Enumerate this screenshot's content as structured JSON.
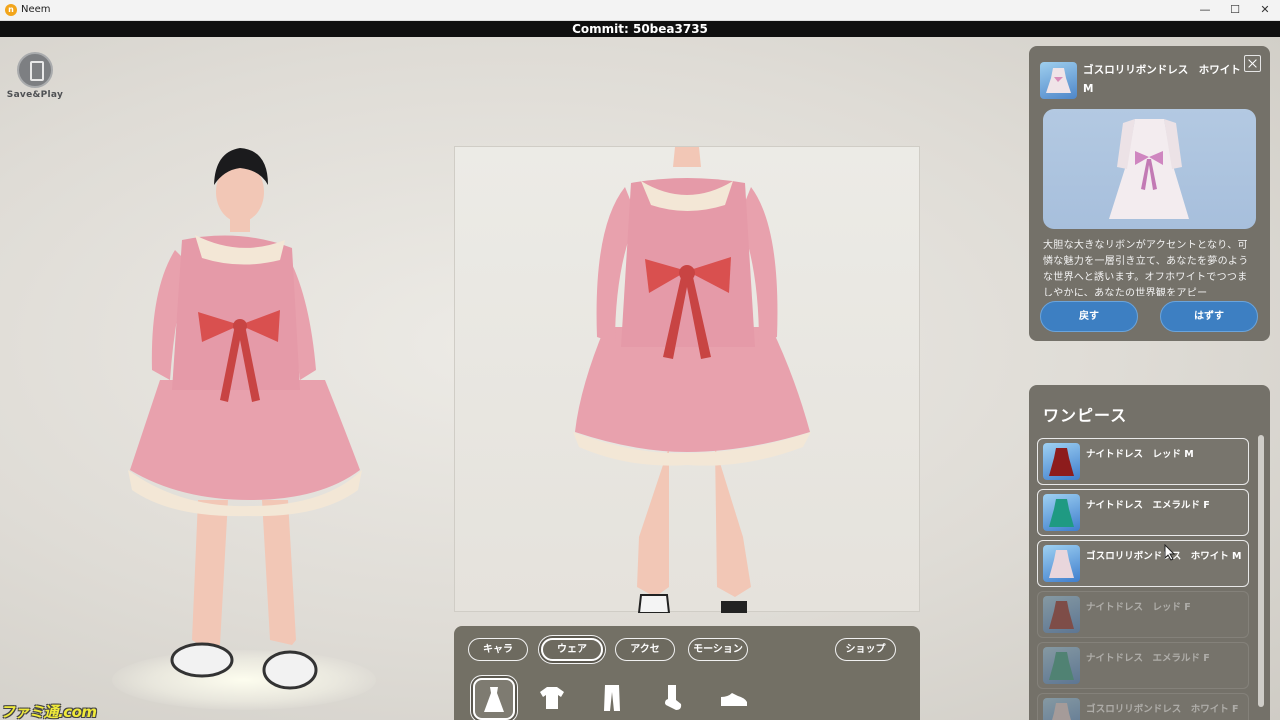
{
  "window": {
    "title": "Neem",
    "app_icon": "n",
    "controls": {
      "minimize": "—",
      "maximize": "☐",
      "close": "✕"
    }
  },
  "commit": "Commit: 50bea3735",
  "save_play": {
    "label": "Save&Play",
    "icon": "door-icon"
  },
  "toolbar": {
    "tabs": [
      {
        "label": "キャラ",
        "active": false
      },
      {
        "label": "ウェア",
        "active": true
      },
      {
        "label": "アクセ",
        "active": false
      },
      {
        "label": "モーション",
        "active": false
      },
      {
        "label": "ショップ",
        "active": false
      }
    ],
    "categories": [
      {
        "icon": "dress-icon",
        "active": true
      },
      {
        "icon": "shirt-icon",
        "active": false
      },
      {
        "icon": "pants-icon",
        "active": false
      },
      {
        "icon": "sock-icon",
        "active": false
      },
      {
        "icon": "shoe-icon",
        "active": false
      }
    ]
  },
  "detail": {
    "title": "ゴスロリリボンドレス　ホワイト M",
    "description": "大胆な大きなリボンがアクセントとなり、可憐な魅力を一層引き立て、あなたを夢のような世界へと誘います。オフホワイトでつつましやかに、あなたの世界観をアピー",
    "button_return": "戻す",
    "button_remove": "はずす"
  },
  "list": {
    "title": "ワンピース",
    "items": [
      {
        "label": "ナイトドレス　レッド M",
        "color": "#8d1c1c",
        "faded": false
      },
      {
        "label": "ナイトドレス　エメラルド F",
        "color": "#1f9a82",
        "faded": false
      },
      {
        "label": "ゴスロリリボンドレス　ホワイト M",
        "color": "#e9d6dc",
        "faded": false
      },
      {
        "label": "ナイトドレス　レッド F",
        "color": "#8d1c1c",
        "faded": true
      },
      {
        "label": "ナイトドレス　エメラルド F",
        "color": "#1f9a82",
        "faded": true
      },
      {
        "label": "ゴスロリリボンドレス　ホワイト F",
        "color": "#e9d6dc",
        "faded": true
      }
    ]
  },
  "watermark": "ファミ通.com",
  "colors": {
    "panel": "#747169",
    "accent_blue": "#3d7fc2",
    "dress_pink": "#e59aa8",
    "ribbon_red": "#d9504f",
    "frill_cream": "#f3e7d6"
  }
}
